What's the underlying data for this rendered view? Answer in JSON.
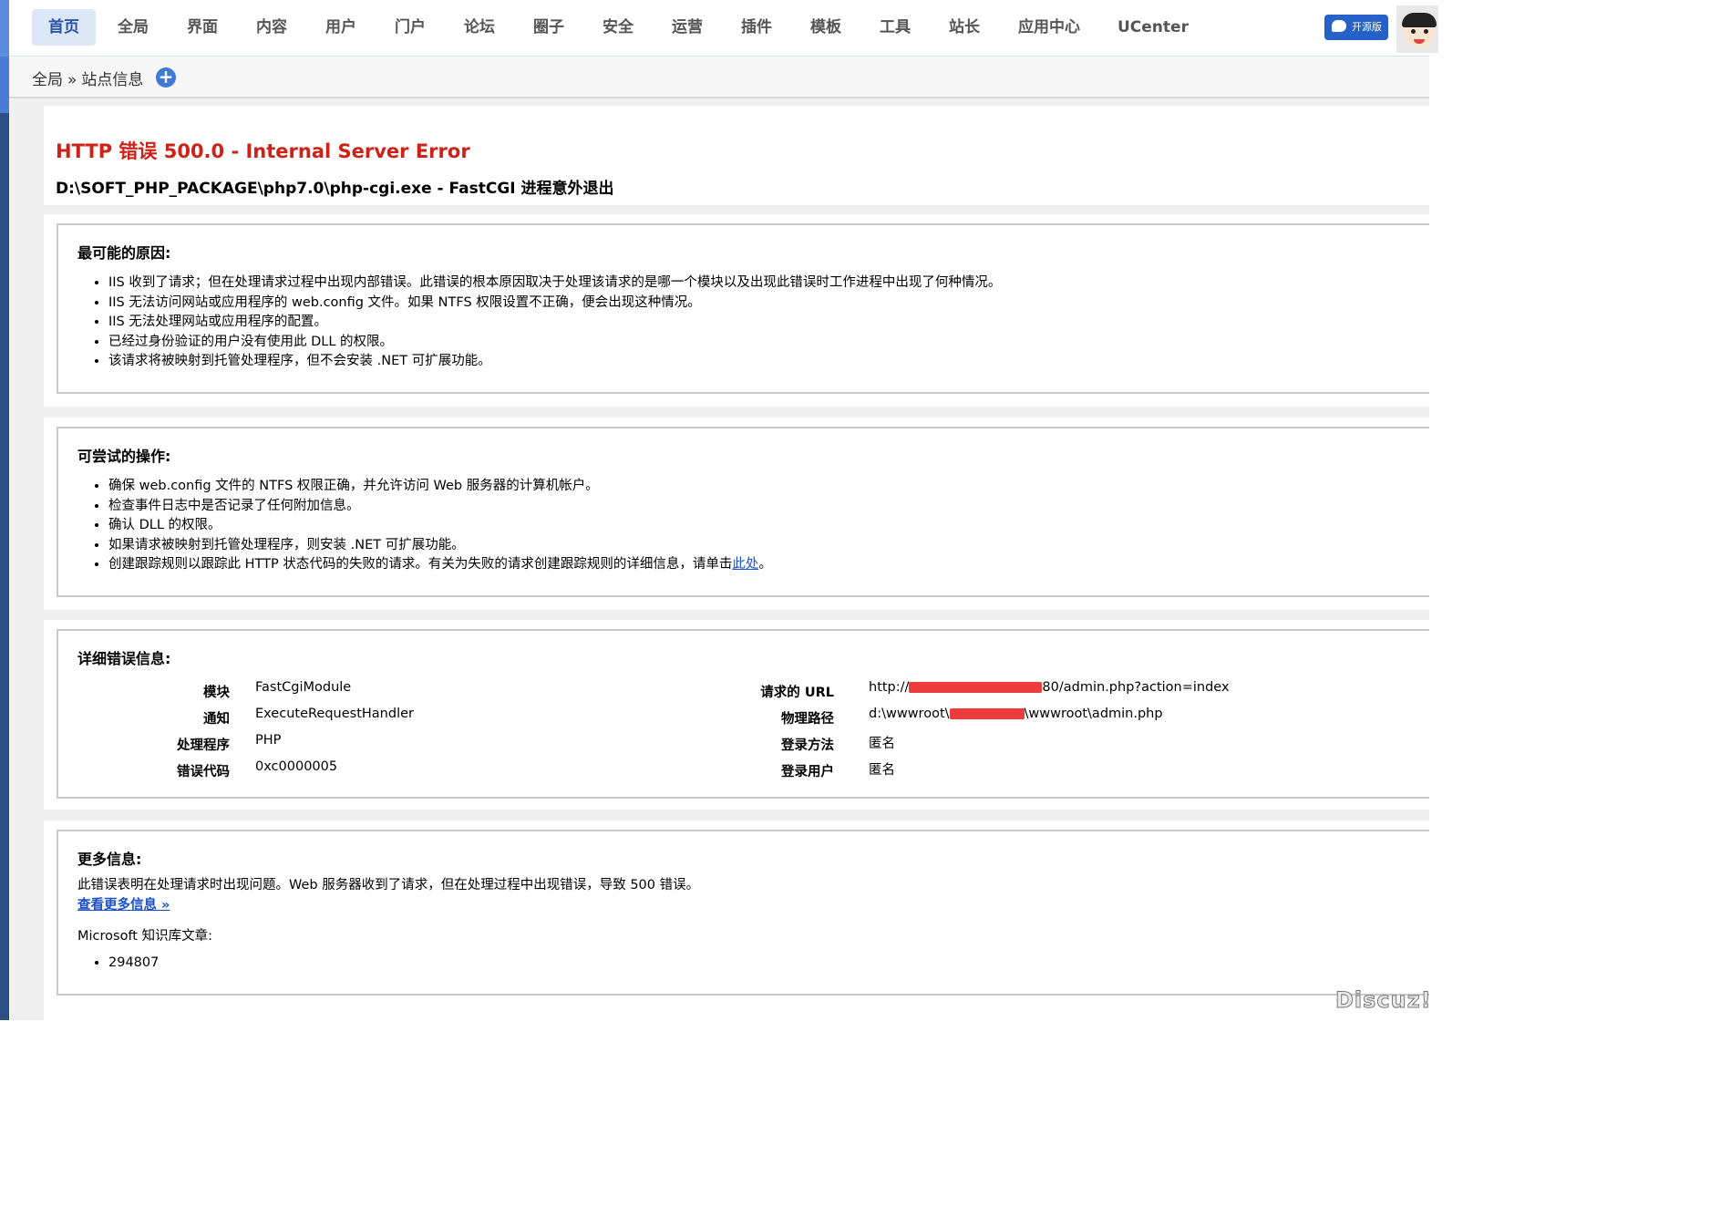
{
  "topnav": {
    "items": [
      "首页",
      "全局",
      "界面",
      "内容",
      "用户",
      "门户",
      "论坛",
      "圈子",
      "安全",
      "运营",
      "插件",
      "模板",
      "工具",
      "站长",
      "应用中心",
      "UCenter"
    ],
    "active_index": 0,
    "open_source_badge": "开源版"
  },
  "breadcrumb": {
    "root": "全局",
    "sep": "»",
    "current": "站点信息",
    "add_icon": "+"
  },
  "error": {
    "title": "HTTP 错误 500.0 - Internal Server Error",
    "subtitle": "D:\\SOFT_PHP_PACKAGE\\php7.0\\php-cgi.exe - FastCGI 进程意外退出"
  },
  "causes": {
    "heading": "最可能的原因:",
    "items": [
      "IIS 收到了请求；但在处理请求过程中出现内部错误。此错误的根本原因取决于处理该请求的是哪一个模块以及出现此错误时工作进程中出现了何种情况。",
      "IIS 无法访问网站或应用程序的 web.config 文件。如果 NTFS 权限设置不正确，便会出现这种情况。",
      "IIS 无法处理网站或应用程序的配置。",
      "已经过身份验证的用户没有使用此 DLL 的权限。",
      "该请求将被映射到托管处理程序，但不会安装 .NET 可扩展功能。"
    ]
  },
  "actions": {
    "heading": "可尝试的操作:",
    "items": [
      "确保 web.config 文件的 NTFS 权限正确，并允许访问 Web 服务器的计算机帐户。",
      "检查事件日志中是否记录了任何附加信息。",
      "确认 DLL 的权限。",
      "如果请求被映射到托管处理程序，则安装 .NET 可扩展功能。"
    ],
    "last_item_text": "创建跟踪规则以跟踪此 HTTP 状态代码的失败的请求。有关为失败的请求创建跟踪规则的详细信息，请单击",
    "last_item_link": "此处",
    "last_item_end": "。"
  },
  "details": {
    "heading": "详细错误信息:",
    "left": [
      {
        "label": "模块",
        "value": "FastCgiModule"
      },
      {
        "label": "通知",
        "value": "ExecuteRequestHandler"
      },
      {
        "label": "处理程序",
        "value": "PHP"
      },
      {
        "label": "错误代码",
        "value": "0xc0000005"
      }
    ],
    "right": [
      {
        "label": "请求的 URL",
        "value_pre": "http://",
        "value_post": "80/admin.php?action=index"
      },
      {
        "label": "物理路径",
        "value_pre": "d:\\wwwroot\\",
        "value_post": "\\wwwroot\\admin.php"
      },
      {
        "label": "登录方法",
        "value_pre": "匿名",
        "value_post": ""
      },
      {
        "label": "登录用户",
        "value_pre": "匿名",
        "value_post": ""
      }
    ]
  },
  "more": {
    "heading": "更多信息:",
    "text": "此错误表明在处理请求时出现问题。Web 服务器收到了请求，但在处理过程中出现错误，导致 500 错误。",
    "link": "查看更多信息 »",
    "kb_label": "Microsoft 知识库文章:",
    "kb_items": [
      "294807"
    ]
  },
  "watermark": "Discuz!"
}
